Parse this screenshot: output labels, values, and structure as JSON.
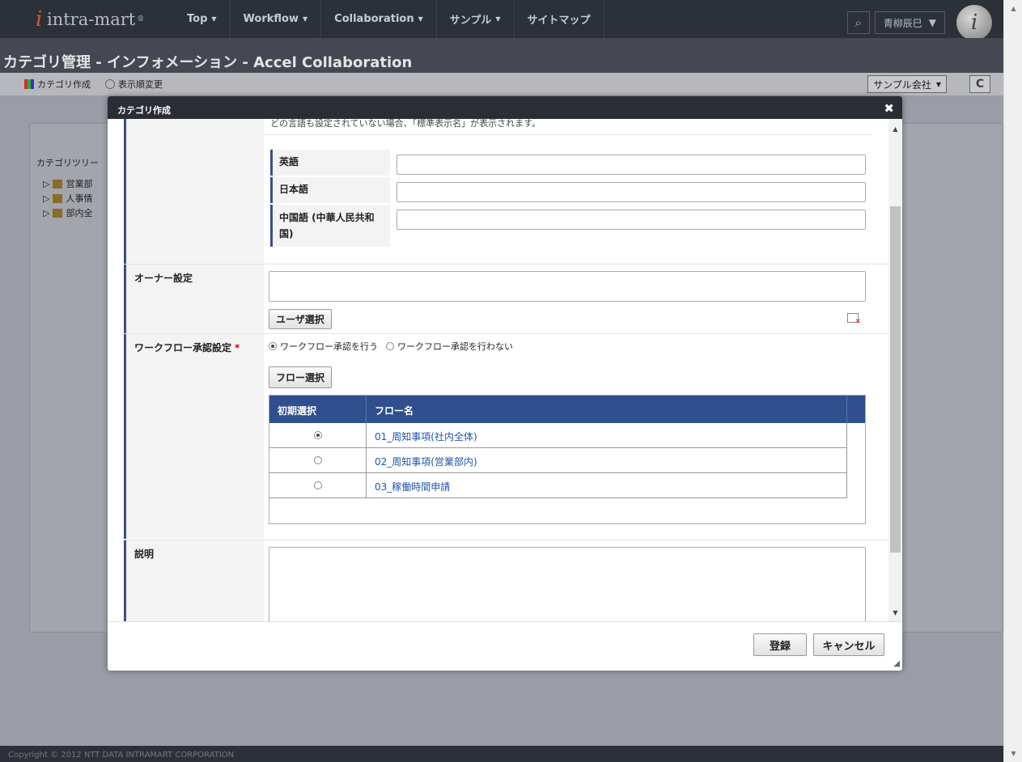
{
  "topnav": {
    "logo_text": "intra-mart",
    "logo_mark": "i",
    "logo_sup": "®",
    "items": [
      {
        "label": "Top"
      },
      {
        "label": "Workflow"
      },
      {
        "label": "Collaboration"
      },
      {
        "label": "サンプル"
      },
      {
        "label": "サイトマップ"
      }
    ],
    "user_name": "青柳辰巳",
    "avatar_mark": "i"
  },
  "page": {
    "title": "カテゴリ管理 - インフォメーション - Accel Collaboration"
  },
  "subbar": {
    "create_label": "カテゴリ作成",
    "order_label": "表示順変更",
    "company": "サンプル会社",
    "refresh_glyph": "C"
  },
  "left_panel": {
    "tree_header": "カテゴリツリー",
    "items": [
      "営業部",
      "人事情",
      "部内全"
    ]
  },
  "footer": {
    "text": "Copyright © 2012 NTT DATA INTRAMART CORPORATION"
  },
  "modal": {
    "title": "カテゴリ作成",
    "close_glyph": "✖",
    "note": "どの言語も設定されていない場合、「標準表示名」が表示されます。",
    "languages": [
      {
        "label": "英語",
        "value": ""
      },
      {
        "label": "日本語",
        "value": ""
      },
      {
        "label": "中国語 (中華人民共和国)",
        "value": ""
      }
    ],
    "owner": {
      "label": "オーナー設定",
      "value": "",
      "select_button": "ユーザ選択"
    },
    "workflow": {
      "label": "ワークフロー承認設定",
      "required_mark": "*",
      "option_on": "ワークフロー承認を行う",
      "option_off": "ワークフロー承認を行わない",
      "selected": "on",
      "flow_button": "フロー選択",
      "table_headers": [
        "初期選択",
        "フロー名"
      ],
      "rows": [
        {
          "name": "01_周知事項(社内全体)",
          "selected": true
        },
        {
          "name": "02_周知事項(営業部内)",
          "selected": false
        },
        {
          "name": "03_稼働時間申請",
          "selected": false
        }
      ]
    },
    "description": {
      "label": "説明",
      "value": ""
    },
    "buttons": {
      "register": "登録",
      "cancel": "キャンセル"
    }
  }
}
